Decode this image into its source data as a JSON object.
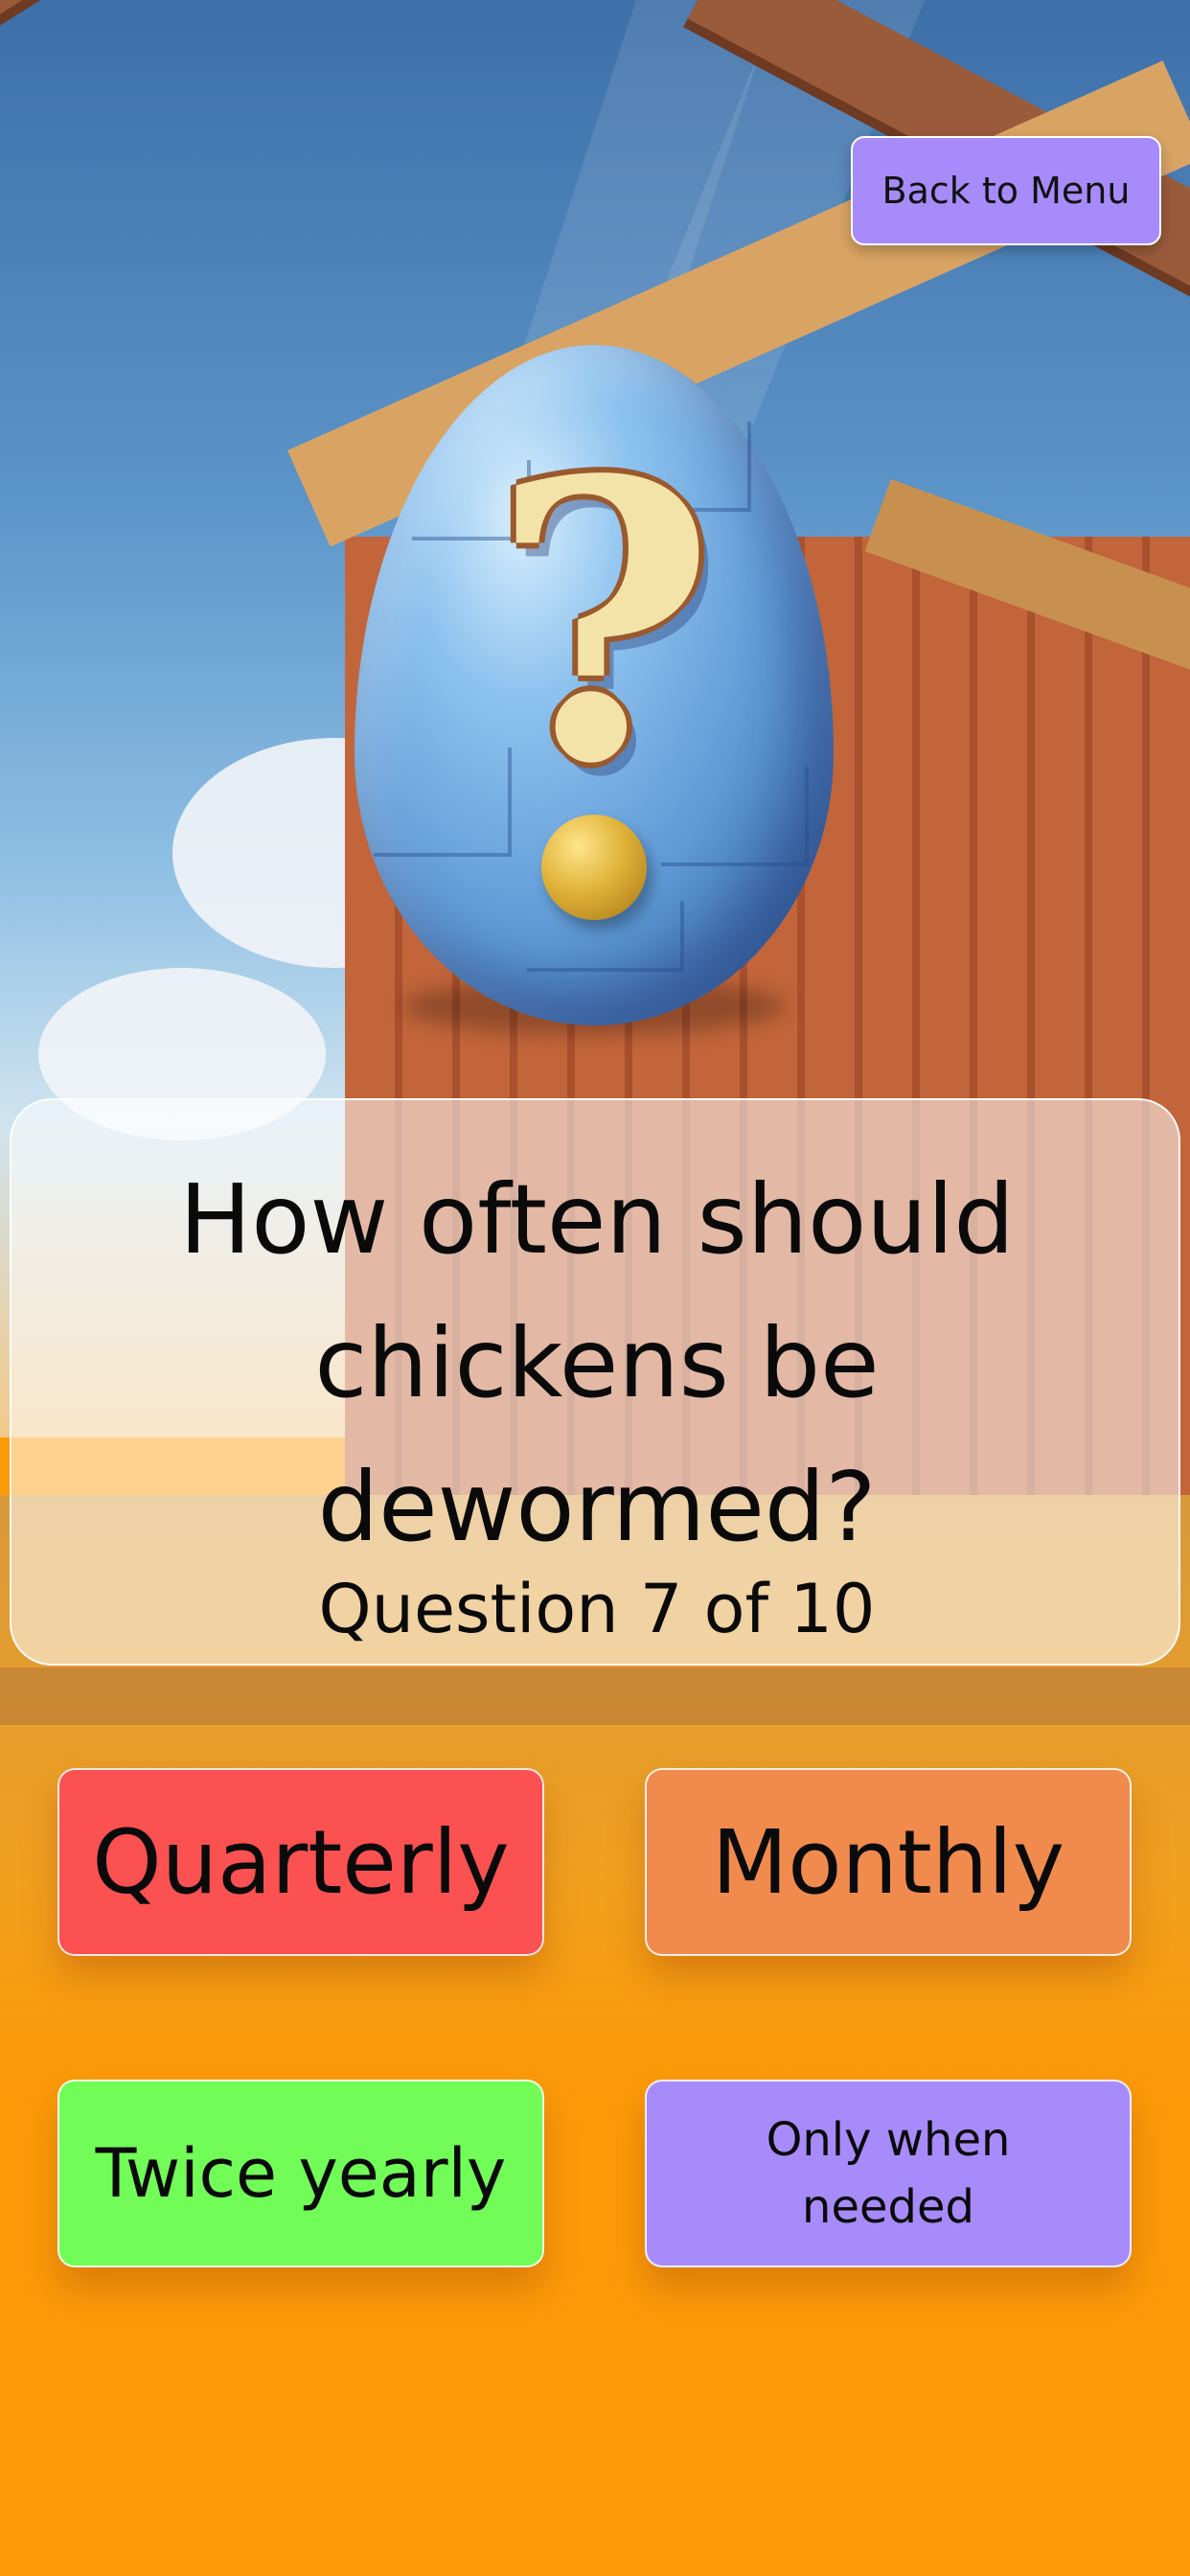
{
  "menu": {
    "back_label": "Back to Menu"
  },
  "question": {
    "text": "How often should chickens be dewormed?",
    "progress": "Question 7 of 10"
  },
  "answers": [
    {
      "label": "Quarterly",
      "color": "#fb5151"
    },
    {
      "label": "Monthly",
      "color": "#f18b4d"
    },
    {
      "label": "Twice yearly",
      "color": "#71fc57"
    },
    {
      "label": "Only when needed",
      "color": "#a78bfa"
    }
  ],
  "illustration": {
    "icon": "question-egg-icon"
  },
  "colors": {
    "background": "#fc9a08",
    "panel": "rgba(255,255,255,0.55)"
  }
}
